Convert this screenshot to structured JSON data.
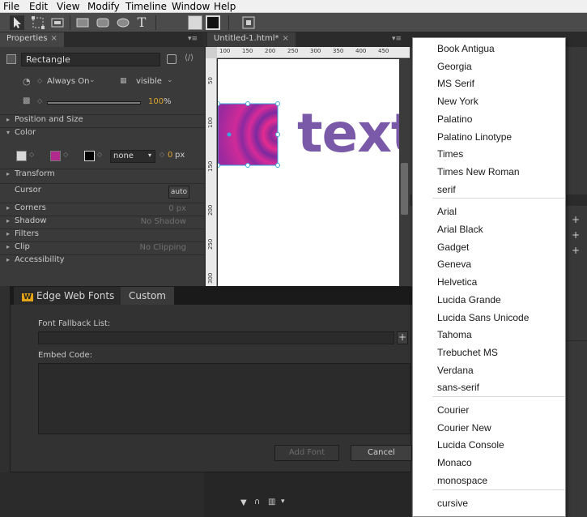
{
  "menu": [
    "File",
    "Edit",
    "View",
    "Modify",
    "Timeline",
    "Window",
    "Help"
  ],
  "toolbar": {
    "tools": [
      "selection-tool",
      "transform-tool",
      "clipping-tool",
      "rectangle-tool",
      "rounded-rectangle-tool",
      "ellipse-tool",
      "text-tool"
    ],
    "text_tool_glyph": "T"
  },
  "properties": {
    "tab_label": "Properties",
    "tab_close": "×",
    "element_type": "Rectangle",
    "display_value": "Always On",
    "visibility_value": "visible",
    "opacity_value": "100",
    "opacity_unit": "%",
    "sections": {
      "position_size": "Position and Size",
      "color": "Color",
      "transform": "Transform",
      "cursor": "Cursor",
      "cursor_value": "auto",
      "corners": "Corners",
      "corners_value": "0 px",
      "shadow": "Shadow",
      "shadow_value": "No Shadow",
      "filters": "Filters",
      "clip": "Clip",
      "clip_value": "No Clipping",
      "accessibility": "Accessibility"
    },
    "border_style": "none",
    "border_width": "0",
    "border_unit": "px"
  },
  "document": {
    "tab_label": "Untitled-1.html*",
    "tab_close": "×",
    "ruler_h": [
      "100",
      "150",
      "200",
      "250",
      "300",
      "350",
      "400",
      "450"
    ],
    "ruler_v": [
      "50",
      "100",
      "150",
      "200",
      "250",
      "300"
    ],
    "stage_text": "text",
    "text_color": "#7a5aa8",
    "rect_color": "#c0288f"
  },
  "dialog": {
    "tab_ewf_icon": "W",
    "tab_ewf": "Edge Web Fonts",
    "tab_custom": "Custom",
    "fallback_label": "Font Fallback List:",
    "embed_label": "Embed Code:",
    "add_font": "Add Font",
    "cancel": "Cancel"
  },
  "font_list": {
    "serif_group": [
      "Book Antigua",
      "Georgia",
      "MS Serif",
      "New York",
      "Palatino",
      "Palatino Linotype",
      "Times",
      "Times New Roman",
      "serif"
    ],
    "sans_group": [
      "Arial",
      "Arial Black",
      "Gadget",
      "Geneva",
      "Helvetica",
      "Lucida Grande",
      "Lucida Sans Unicode",
      "Tahoma",
      "Trebuchet MS",
      "Verdana",
      "sans-serif"
    ],
    "mono_group": [
      "Courier",
      "Courier New",
      "Lucida Console",
      "Monaco",
      "monospace"
    ],
    "cursive_group": [
      "cursive"
    ]
  }
}
